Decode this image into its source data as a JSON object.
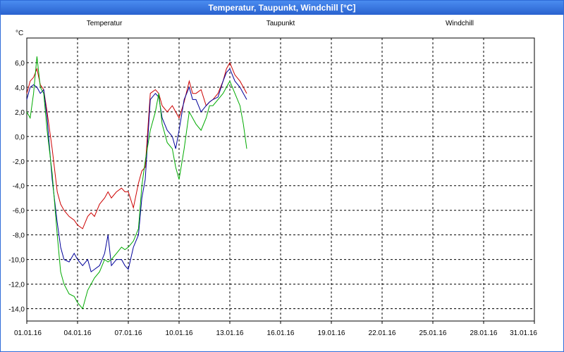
{
  "window": {
    "title": "Temperatur, Taupunkt, Windchill [°C]"
  },
  "colors": {
    "temperatur": "#cc0000",
    "taupunkt": "#000099",
    "windchill": "#00aa00",
    "grid": "#000000",
    "background": "#ffffff"
  },
  "chart_data": {
    "type": "line",
    "title": "Temperatur, Taupunkt, Windchill [°C]",
    "ylabel": "°C",
    "xlabel": "",
    "ylim": [
      -15,
      8
    ],
    "xlim": [
      0,
      30
    ],
    "grid": true,
    "yticks": [
      "6,0",
      "4,0",
      "2,0",
      "0,0",
      "-2,0",
      "-4,0",
      "-6,0",
      "-8,0",
      "-10,0",
      "-12,0",
      "-14,0"
    ],
    "ytick_values": [
      6,
      4,
      2,
      0,
      -2,
      -4,
      -6,
      -8,
      -10,
      -12,
      -14
    ],
    "xticks": [
      "01.01.16",
      "04.01.16",
      "07.01.16",
      "10.01.16",
      "13.01.16",
      "16.01.16",
      "19.01.16",
      "22.01.16",
      "25.01.16",
      "28.01.16",
      "31.01.16"
    ],
    "xtick_values": [
      0,
      3,
      6,
      9,
      12,
      15,
      18,
      21,
      24,
      27,
      30
    ],
    "legend_placement": "top",
    "series": [
      {
        "name": "Temperatur",
        "color": "#cc0000",
        "x": [
          0,
          0.2,
          0.4,
          0.6,
          0.8,
          1.0,
          1.2,
          1.5,
          1.8,
          2.0,
          2.2,
          2.5,
          2.8,
          3.0,
          3.3,
          3.6,
          3.8,
          4.0,
          4.3,
          4.6,
          4.8,
          5.0,
          5.3,
          5.6,
          5.8,
          6.0,
          6.3,
          6.6,
          6.8,
          7.0,
          7.3,
          7.6,
          7.8,
          8.0,
          8.3,
          8.6,
          8.8,
          9.0,
          9.3,
          9.6,
          9.8,
          10.0,
          10.3,
          10.6,
          10.8,
          11.0,
          11.3,
          11.6,
          11.8,
          12.0,
          12.3,
          12.6,
          12.8,
          13.0
        ],
        "y": [
          3.5,
          4.5,
          4.8,
          5.5,
          4.2,
          3.8,
          2.0,
          -1.0,
          -4.5,
          -5.5,
          -6.0,
          -6.5,
          -6.8,
          -7.2,
          -7.5,
          -6.5,
          -6.2,
          -6.5,
          -5.5,
          -5.0,
          -4.5,
          -5.0,
          -4.5,
          -4.2,
          -4.5,
          -4.5,
          -5.8,
          -3.8,
          -2.8,
          -2.5,
          3.5,
          3.8,
          3.5,
          2.5,
          2.0,
          2.5,
          2.0,
          1.5,
          2.8,
          4.5,
          3.5,
          3.5,
          3.8,
          2.5,
          2.8,
          3.0,
          3.5,
          4.5,
          5.5,
          6.0,
          5.0,
          4.5,
          4.0,
          3.5
        ]
      },
      {
        "name": "Taupunkt",
        "color": "#000099",
        "x": [
          0,
          0.2,
          0.4,
          0.6,
          0.8,
          1.0,
          1.2,
          1.5,
          1.8,
          2.0,
          2.2,
          2.5,
          2.8,
          3.0,
          3.3,
          3.6,
          3.8,
          4.0,
          4.3,
          4.6,
          4.8,
          5.0,
          5.3,
          5.6,
          5.8,
          6.0,
          6.3,
          6.6,
          6.8,
          7.0,
          7.3,
          7.6,
          7.8,
          8.0,
          8.3,
          8.6,
          8.8,
          9.0,
          9.3,
          9.6,
          9.8,
          10.0,
          10.3,
          10.6,
          10.8,
          11.0,
          11.3,
          11.6,
          11.8,
          12.0,
          12.3,
          12.6,
          12.8,
          13.0
        ],
        "y": [
          3.0,
          4.0,
          4.2,
          4.0,
          3.5,
          3.8,
          1.5,
          -3.5,
          -7.0,
          -9.0,
          -10.0,
          -10.2,
          -9.5,
          -10.0,
          -10.5,
          -10.0,
          -11.0,
          -10.8,
          -10.5,
          -9.5,
          -8.0,
          -10.5,
          -10.0,
          -10.0,
          -10.5,
          -10.8,
          -9.0,
          -8.0,
          -5.0,
          -3.5,
          3.0,
          3.5,
          3.2,
          1.5,
          0.5,
          0.0,
          -1.0,
          0.5,
          3.0,
          4.0,
          3.0,
          3.0,
          2.0,
          2.5,
          2.8,
          3.0,
          3.2,
          4.5,
          5.2,
          5.5,
          4.5,
          4.0,
          3.5,
          3.0
        ]
      },
      {
        "name": "Windchill",
        "color": "#00aa00",
        "x": [
          0,
          0.2,
          0.4,
          0.6,
          0.8,
          1.0,
          1.2,
          1.5,
          1.8,
          2.0,
          2.2,
          2.5,
          2.8,
          3.0,
          3.3,
          3.6,
          3.8,
          4.0,
          4.3,
          4.6,
          4.8,
          5.0,
          5.3,
          5.6,
          5.8,
          6.0,
          6.3,
          6.6,
          6.8,
          7.0,
          7.3,
          7.6,
          7.8,
          8.0,
          8.3,
          8.6,
          8.8,
          9.0,
          9.3,
          9.6,
          9.8,
          10.0,
          10.3,
          10.6,
          10.8,
          11.0,
          11.3,
          11.6,
          11.8,
          12.0,
          12.3,
          12.6,
          12.8,
          13.0
        ],
        "y": [
          2.0,
          1.5,
          3.5,
          6.5,
          4.0,
          3.5,
          0.5,
          -3.0,
          -8.0,
          -11.0,
          -12.0,
          -12.8,
          -13.0,
          -13.5,
          -14.0,
          -12.5,
          -12.0,
          -11.5,
          -11.0,
          -10.0,
          -10.2,
          -10.0,
          -9.5,
          -9.0,
          -9.2,
          -9.0,
          -8.5,
          -7.5,
          -4.0,
          -2.0,
          0.5,
          2.0,
          3.5,
          1.0,
          -0.5,
          -1.0,
          -2.5,
          -3.5,
          -1.0,
          2.0,
          1.5,
          1.0,
          0.5,
          1.5,
          2.5,
          2.5,
          3.0,
          3.5,
          4.0,
          4.5,
          3.5,
          2.5,
          1.0,
          -1.0
        ]
      }
    ]
  }
}
